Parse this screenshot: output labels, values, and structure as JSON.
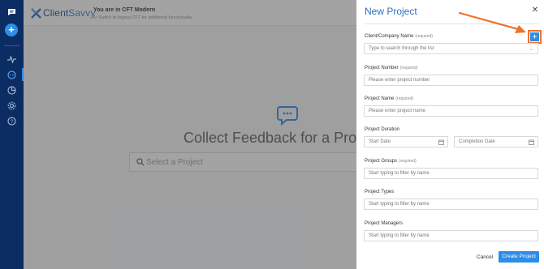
{
  "brand": {
    "name_part1": "Client",
    "name_part2": "Savvy"
  },
  "banner": {
    "title": "You are in CFT Modern",
    "subtitle": "Switch to legacy CFT for additional functionality"
  },
  "main": {
    "hero_title": "Collect Feedback for a Pro",
    "search_placeholder": "Select a Project"
  },
  "drawer": {
    "title": "New Project",
    "close_icon": "close-icon",
    "fields": {
      "client": {
        "label": "Client/Company Name",
        "required": "(required)",
        "placeholder": "Type to search through the list"
      },
      "project_number": {
        "label": "Project Number",
        "required": "(required)",
        "placeholder": "Please enter project number"
      },
      "project_name": {
        "label": "Project Name",
        "required": "(required)",
        "placeholder": "Please enter project name"
      },
      "duration": {
        "label": "Project Duration",
        "start_placeholder": "Start Date",
        "end_placeholder": "Completion Date"
      },
      "groups": {
        "label": "Project Groups",
        "required": "(required)",
        "placeholder": "Start typing to filter by name"
      },
      "types": {
        "label": "Project Types",
        "placeholder": "Start typing to filter by name"
      },
      "managers": {
        "label": "Project Managers",
        "placeholder": "Start typing to filter by name"
      }
    },
    "add_label": "+",
    "cancel_label": "Cancel",
    "create_label": "Create Project"
  },
  "colors": {
    "accent": "#2e8de6",
    "rail": "#0b2d63",
    "highlight": "#f0712c",
    "title": "#2d6fc2"
  }
}
